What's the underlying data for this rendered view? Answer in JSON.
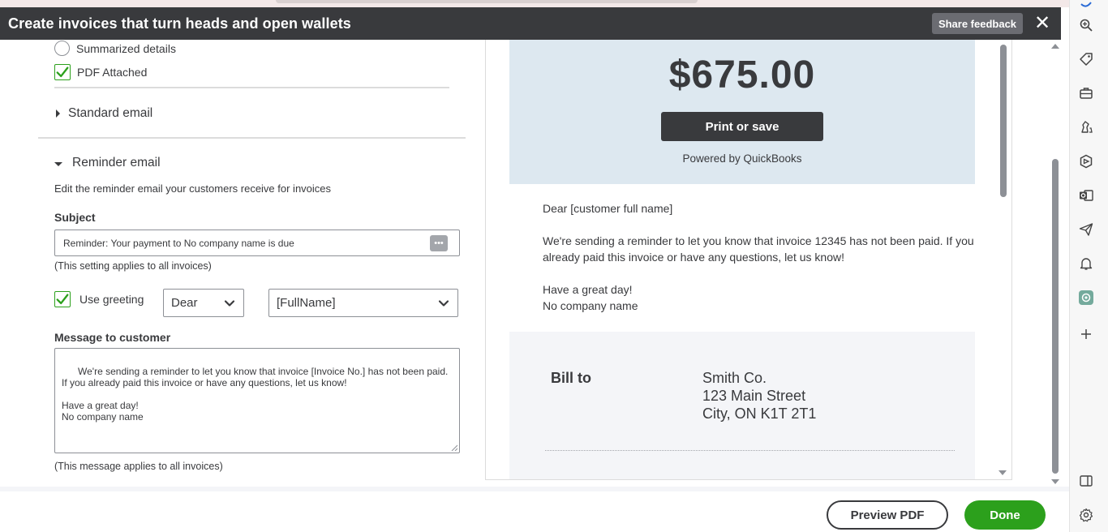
{
  "header": {
    "title": "Create invoices that turn heads and open wallets",
    "share_feedback_label": "Share feedback",
    "close_symbol": "✕"
  },
  "attachments": {
    "summarized_details_label": "Summarized details",
    "summarized_details_checked": false,
    "pdf_attached_label": "PDF Attached",
    "pdf_attached_checked": true
  },
  "standard_email": {
    "label": "Standard email",
    "expanded": false
  },
  "reminder_email": {
    "label": "Reminder email",
    "expanded": true,
    "description": "Edit the reminder email your customers receive for invoices",
    "subject_label": "Subject",
    "subject_value": "Reminder: Your payment to No company name is due",
    "subject_note": "(This setting applies to all invoices)",
    "use_greeting_label": "Use greeting",
    "use_greeting_checked": true,
    "greeting_value": "Dear",
    "name_value": "[FullName]",
    "message_label": "Message to customer",
    "message_value": "We're sending a reminder to let you know that invoice [Invoice No.] has not been paid. If you already paid this invoice or have any questions, let us know!\n\nHave a great day!\nNo company name",
    "message_note": "(This message applies to all invoices)"
  },
  "preview": {
    "amount": "$675.00",
    "print_button": "Print or save",
    "powered_by": "Powered by QuickBooks",
    "greeting_line": "Dear [customer full name]",
    "body_paragraph": "We're sending a reminder to let you know that invoice 12345 has not been paid. If you already paid this invoice or have any questions, let us know!",
    "closing_line1": "Have a great day!",
    "closing_line2": "No company name",
    "bill_to_label": "Bill to",
    "bill_to_name": "Smith Co.",
    "bill_to_street": "123 Main Street",
    "bill_to_city": "City, ON K1T 2T1"
  },
  "footer": {
    "preview_pdf_label": "Preview PDF",
    "done_label": "Done"
  },
  "edge_sidebar": {
    "icons": [
      "zoom-icon",
      "tag-icon",
      "briefcase-icon",
      "chess-icon",
      "hexagon-icon",
      "outlook-icon",
      "send-icon",
      "bell-icon",
      "chatgpt-icon",
      "plus-icon",
      "split-view-icon",
      "settings-icon"
    ]
  },
  "colors": {
    "header_bg": "#393a3d",
    "brand_green": "#2ca01c",
    "pay_card_bg": "#dde8f0",
    "bill_card_bg": "#f4f5f8"
  }
}
